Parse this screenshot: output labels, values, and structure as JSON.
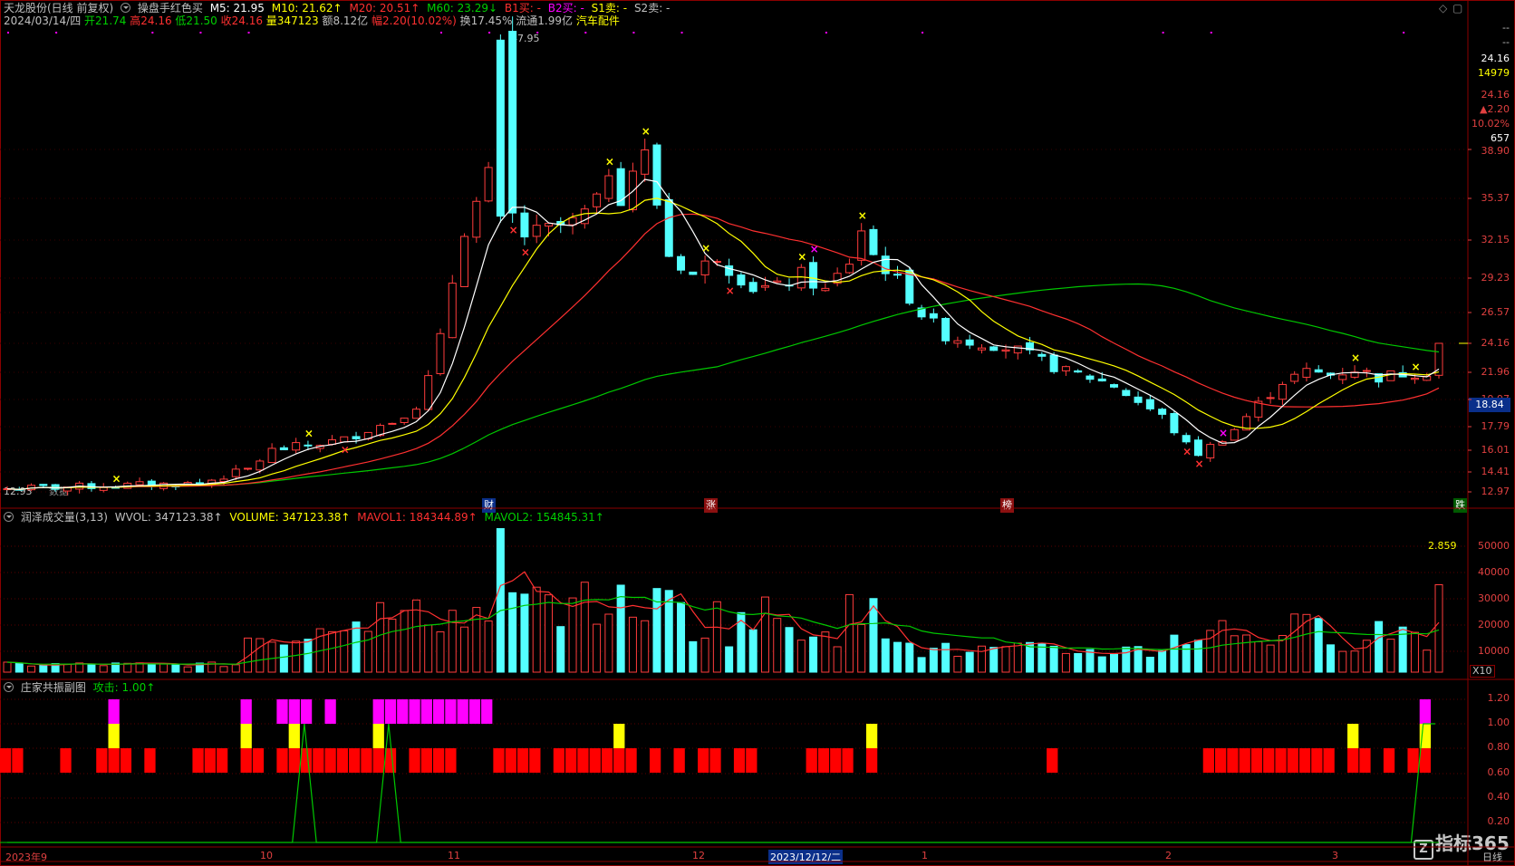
{
  "header": {
    "stock_name": "天龙股份(日线 前复权)",
    "indicator_name": "操盘手红色买",
    "ma5": "M5: 21.95",
    "ma10": "M10: 21.62↑",
    "ma20": "M20: 20.51↑",
    "ma60": "M60: 23.29↓",
    "b1": "B1买: -",
    "b2": "B2买: -",
    "s1": "S1卖: -",
    "s2": "S2卖: -"
  },
  "info": {
    "date": "2024/03/14/四",
    "open": "开21.74",
    "high": "高24.16",
    "low": "低21.50",
    "close": "收24.16",
    "volume": "量347123",
    "amount": "额8.12亿",
    "change": "幅2.20(10.02%)",
    "turnover": "换17.45%",
    "float_cap": "流通1.99亿",
    "sector": "汽车配件"
  },
  "price_panel": {
    "peak_label": "47.95",
    "low_label": "12.93",
    "no_data_label": "数据",
    "event_tags": [
      "财",
      "涨",
      "榜",
      "跌"
    ],
    "current_price_tag": "18.84"
  },
  "right_info": {
    "dash1": "--",
    "dash2": "--",
    "price": "24.16",
    "vol": "14979",
    "price2": "24.16",
    "up": "▲2.20",
    "pct": "10.02%",
    "num": "657"
  },
  "price_ticks": [
    "38.90",
    "35.37",
    "32.15",
    "29.23",
    "26.57",
    "24.16",
    "21.96",
    "19.97",
    "17.79",
    "16.01",
    "14.41",
    "12.97"
  ],
  "vol_panel": {
    "title": "润泽成交量(3,13)",
    "wvol": "WVOL: 347123.38↑",
    "volume": "VOLUME: 347123.38↑",
    "mavol1": "MAVOL1: 184344.89↑",
    "mavol2": "MAVOL2: 154845.31↑",
    "ratio": "2.859",
    "unit": "X10",
    "ticks": [
      "50000",
      "40000",
      "30000",
      "20000",
      "10000"
    ]
  },
  "sub_panel": {
    "title": "庄家共振副图",
    "attack": "攻击: 1.00↑",
    "ticks": [
      "1.20",
      "1.00",
      "0.80",
      "0.60",
      "0.40",
      "0.20"
    ]
  },
  "x_axis": {
    "labels": [
      "2023年9",
      "10",
      "11",
      "12",
      "2023/12/12/二",
      "1",
      "2",
      "3"
    ],
    "period": "日线"
  },
  "watermark": "指标365",
  "colors": {
    "up": "#ff3c3c",
    "down": "#54ffff",
    "ma5": "#ffffff",
    "ma10": "#ffff00",
    "ma20": "#ff3030",
    "ma60": "#00c800",
    "magenta": "#ff00ff",
    "yellow": "#ffff00",
    "grid": "#8b0000"
  }
}
